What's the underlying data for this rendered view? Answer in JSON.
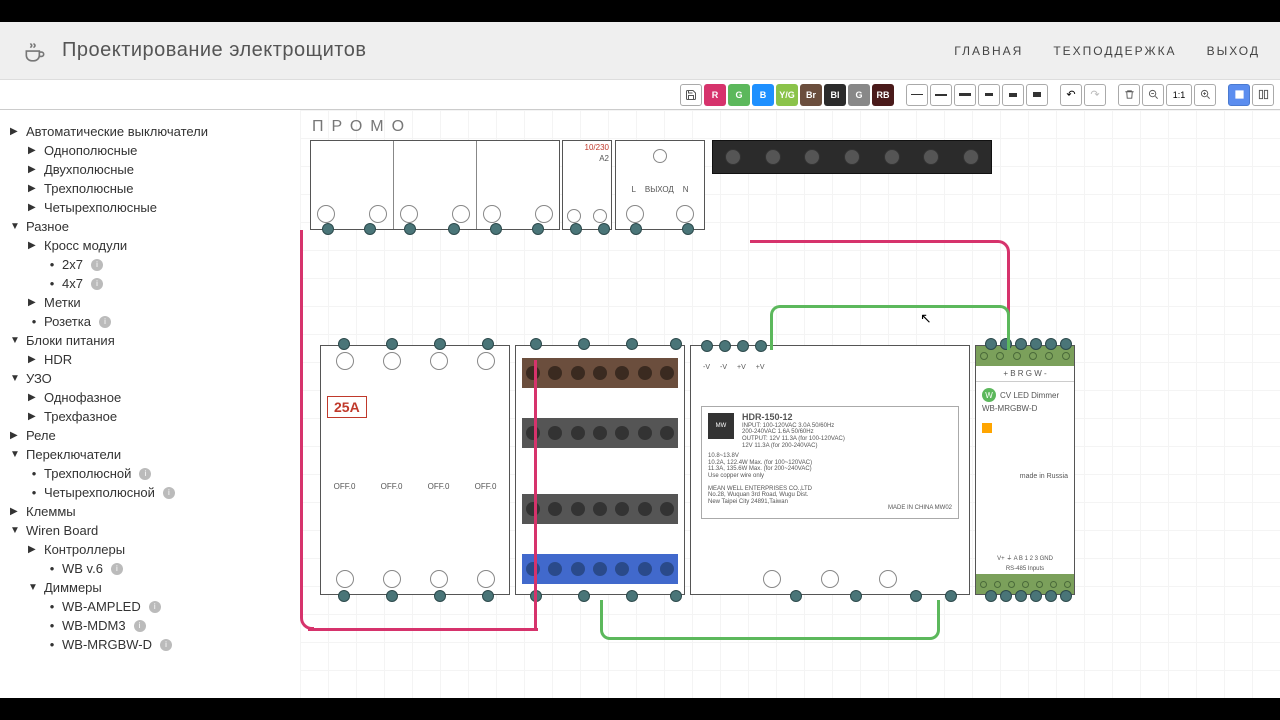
{
  "header": {
    "title": "Проектирование электрощитов",
    "nav": [
      "ГЛАВНАЯ",
      "ТЕХПОДДЕРЖКА",
      "ВЫХОД"
    ]
  },
  "toolbar": {
    "colors": [
      {
        "bg": "#d6336c",
        "label": "R"
      },
      {
        "bg": "#5cb85c",
        "label": "G"
      },
      {
        "bg": "#1e90ff",
        "label": "B"
      },
      {
        "bg": "#8bc34a",
        "label": "Y/G"
      },
      {
        "bg": "#6b4e3d",
        "label": "Br"
      },
      {
        "bg": "#2b2b2b",
        "label": "Bl"
      },
      {
        "bg": "#888",
        "label": "G"
      },
      {
        "bg": "#4a1a1a",
        "label": "RB"
      }
    ],
    "ratio": "1:1"
  },
  "canvas": {
    "title": "ПРОМО",
    "label_25a": "25A",
    "off": "OFF.0",
    "small_label_top": "10/230",
    "out_block": {
      "l": "L",
      "out": "ВЫХОД",
      "n": "N",
      "a2": "A2"
    },
    "psu": {
      "model": "HDR-150-12",
      "input": "INPUT: 100-120VAC  3.0A   50/60Hz",
      "input2": "200-240VAC  1.6A   50/60Hz",
      "output": "OUTPUT: 12V   11.3A   (for 100-120VAC)",
      "output2": "12V   11.3A   (for 200-240VAC)",
      "notes_a": "10.8~13.8V",
      "notes_b": "10.2A, 122.4W Max. (for 100~120VAC)",
      "notes_c": "11.3A, 135.6W Max. (for 200~240VAC)",
      "copper": "Use copper wire only",
      "mfg1": "MEAN WELL ENTERPRISES CO.,LTD",
      "mfg2": "No.28, Wuquan 3rd Road, Wugu Dist.",
      "mfg3": "New Taipei City 24891,Taiwan",
      "made": "MADE IN CHINA  MW02",
      "terms": [
        "-V",
        "-V",
        "+V",
        "+V"
      ]
    },
    "dimmer": {
      "top_row": "+  B   R  G  W  -",
      "title": "CV LED Dimmer",
      "model": "WB-MRGBW-D",
      "made": "made in Russia",
      "bottom": "RS-485   Inputs",
      "bottom2": "V+ ⏚ A  B    1  2  3 GND"
    }
  },
  "sidebar": {
    "tree": [
      {
        "t": "caret",
        "open": false,
        "label": "Автоматические выключатели",
        "lvl": 0
      },
      {
        "t": "caret",
        "open": false,
        "label": "Однополюсные",
        "lvl": 1
      },
      {
        "t": "caret",
        "open": false,
        "label": "Двухполюсные",
        "lvl": 1
      },
      {
        "t": "caret",
        "open": false,
        "label": "Трехполюсные",
        "lvl": 1
      },
      {
        "t": "caret",
        "open": false,
        "label": "Четырехполюсные",
        "lvl": 1
      },
      {
        "t": "caret",
        "open": true,
        "label": "Разное",
        "lvl": 0
      },
      {
        "t": "caret",
        "open": false,
        "label": "Кросс модули",
        "lvl": 1
      },
      {
        "t": "bullet",
        "label": "2x7",
        "lvl": 2,
        "info": true
      },
      {
        "t": "bullet",
        "label": "4x7",
        "lvl": 2,
        "info": true
      },
      {
        "t": "caret",
        "open": false,
        "label": "Метки",
        "lvl": 1
      },
      {
        "t": "bullet",
        "label": "Розетка",
        "lvl": 1,
        "info": true
      },
      {
        "t": "caret",
        "open": true,
        "label": "Блоки питания",
        "lvl": 0
      },
      {
        "t": "caret",
        "open": false,
        "label": "HDR",
        "lvl": 1
      },
      {
        "t": "caret",
        "open": true,
        "label": "УЗО",
        "lvl": 0
      },
      {
        "t": "caret",
        "open": false,
        "label": "Однофазное",
        "lvl": 1
      },
      {
        "t": "caret",
        "open": false,
        "label": "Трехфазное",
        "lvl": 1
      },
      {
        "t": "caret",
        "open": false,
        "label": "Реле",
        "lvl": 0
      },
      {
        "t": "caret",
        "open": true,
        "label": "Переключатели",
        "lvl": 0
      },
      {
        "t": "bullet",
        "label": "Трехполюсной",
        "lvl": 1,
        "info": true
      },
      {
        "t": "bullet",
        "label": "Четырехполюсной",
        "lvl": 1,
        "info": true
      },
      {
        "t": "caret",
        "open": false,
        "label": "Клеммы",
        "lvl": 0
      },
      {
        "t": "caret",
        "open": true,
        "label": "Wiren Board",
        "lvl": 0
      },
      {
        "t": "caret",
        "open": false,
        "label": "Контроллеры",
        "lvl": 1
      },
      {
        "t": "bullet",
        "label": "WB v.6",
        "lvl": 2,
        "info": true
      },
      {
        "t": "caret",
        "open": true,
        "label": "Диммеры",
        "lvl": 1
      },
      {
        "t": "bullet",
        "label": "WB-AMPLED",
        "lvl": 2,
        "info": true
      },
      {
        "t": "bullet",
        "label": "WB-MDM3",
        "lvl": 2,
        "info": true
      },
      {
        "t": "bullet",
        "label": "WB-MRGBW-D",
        "lvl": 2,
        "info": true
      }
    ]
  }
}
